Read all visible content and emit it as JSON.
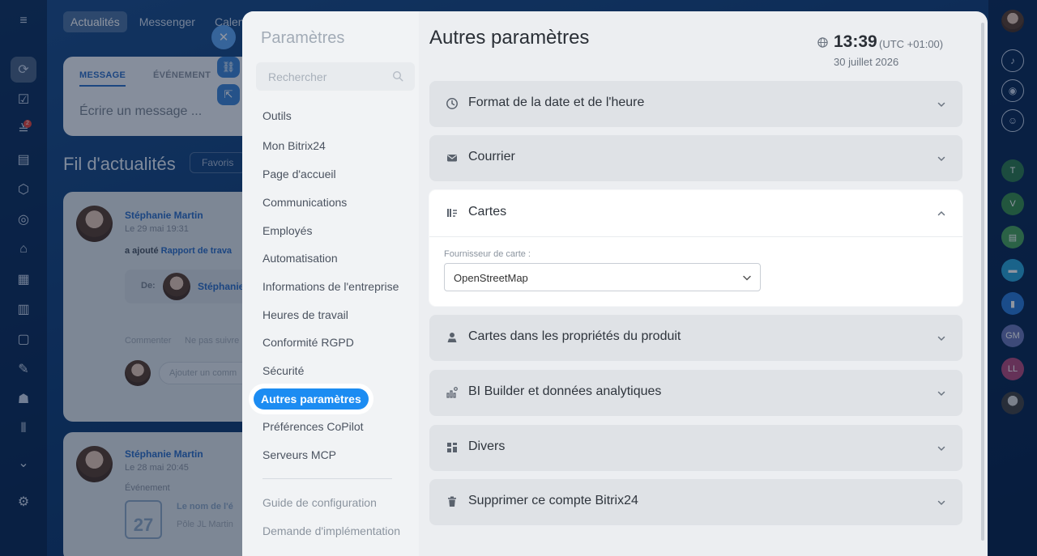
{
  "background": {
    "top_tabs": [
      "Actualités",
      "Messenger",
      "Calend"
    ],
    "composer": {
      "tabs": [
        "MESSAGE",
        "ÉVÉNEMENT"
      ],
      "placeholder": "Écrire un message ..."
    },
    "feed_title": "Fil d'actualités",
    "feed_filter": "Favoris",
    "post1": {
      "author": "Stéphanie Martin",
      "date": "Le 29 mai 19:31",
      "action": "a ajouté",
      "link": "Rapport de trava",
      "from_label": "De:",
      "from_name": "Stéphanie",
      "comment": "Commenter",
      "unfollow": "Ne pas suivre",
      "comment_placeholder": "Ajouter un comm"
    },
    "post2": {
      "author": "Stéphanie Martin",
      "date": "Le 28 mai 20:45",
      "type": "Événement",
      "event_title": "Le nom de l'é",
      "event_day": "27",
      "event_where": "Pôle JL Martin"
    },
    "rail_badge": "2",
    "right_rail_initials": [
      "T",
      "V",
      "GM",
      "LL"
    ]
  },
  "sidebar": {
    "title": "Paramètres",
    "search_placeholder": "Rechercher",
    "items": [
      "Outils",
      "Mon Bitrix24",
      "Page d'accueil",
      "Communications",
      "Employés",
      "Automatisation",
      "Informations de l'entreprise",
      "Heures de travail",
      "Conformité RGPD",
      "Sécurité",
      "Autres paramètres",
      "Préférences CoPilot",
      "Serveurs MCP"
    ],
    "active_item": "Autres paramètres",
    "footer_items": [
      "Guide de configuration",
      "Demande d'implémentation"
    ]
  },
  "main": {
    "title": "Autres paramètres",
    "clock": {
      "time": "13:39",
      "timezone": "(UTC +01:00)",
      "date": "30 juillet 2026"
    },
    "sections": [
      {
        "label": "Format de la date et de l'heure",
        "icon": "clock-icon",
        "expanded": false
      },
      {
        "label": "Courrier",
        "icon": "mail-icon",
        "expanded": false
      },
      {
        "label": "Cartes",
        "icon": "map-icon",
        "expanded": true
      },
      {
        "label": "Cartes dans les propriétés du produit",
        "icon": "map-pin-icon",
        "expanded": false
      },
      {
        "label": "BI Builder et données analytiques",
        "icon": "analytics-icon",
        "expanded": false
      },
      {
        "label": "Divers",
        "icon": "grid-icon",
        "expanded": false
      },
      {
        "label": "Supprimer ce compte Bitrix24",
        "icon": "trash-icon",
        "expanded": false
      }
    ],
    "cartes": {
      "field_label": "Fournisseur de carte :",
      "provider": "OpenStreetMap"
    }
  },
  "colors": {
    "accent": "#1c8cf2",
    "panel_bg": "#eceef1",
    "section_bg": "#dfe2e6"
  }
}
